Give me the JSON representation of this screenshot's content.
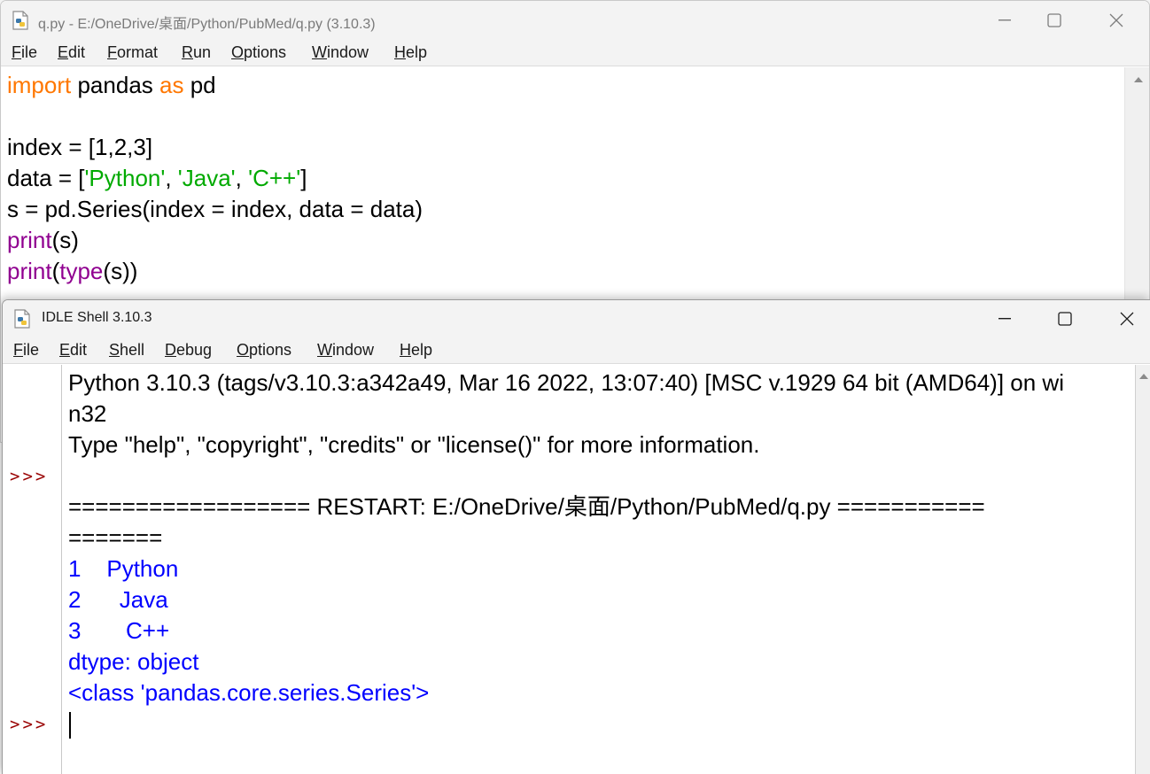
{
  "editor": {
    "title": "q.py - E:/OneDrive/桌面/Python/PubMed/q.py (3.10.3)",
    "menu": [
      "File",
      "Edit",
      "Format",
      "Run",
      "Options",
      "Window",
      "Help"
    ],
    "code": [
      [
        {
          "t": "import",
          "c": "kw"
        },
        {
          "t": " pandas ",
          "c": ""
        },
        {
          "t": "as",
          "c": "kw"
        },
        {
          "t": " pd",
          "c": ""
        }
      ],
      [],
      [
        {
          "t": "index = [1,2,3]",
          "c": ""
        }
      ],
      [
        {
          "t": "data = [",
          "c": ""
        },
        {
          "t": "'Python'",
          "c": "st"
        },
        {
          "t": ", ",
          "c": ""
        },
        {
          "t": "'Java'",
          "c": "st"
        },
        {
          "t": ", ",
          "c": ""
        },
        {
          "t": "'C++'",
          "c": "st"
        },
        {
          "t": "]",
          "c": ""
        }
      ],
      [
        {
          "t": "s = pd.Series(index = index, data = data)",
          "c": ""
        }
      ],
      [
        {
          "t": "print",
          "c": "bi"
        },
        {
          "t": "(s)",
          "c": ""
        }
      ],
      [
        {
          "t": "print",
          "c": "bi"
        },
        {
          "t": "(",
          "c": ""
        },
        {
          "t": "type",
          "c": "bi"
        },
        {
          "t": "(s))",
          "c": ""
        }
      ]
    ]
  },
  "shell": {
    "title": "IDLE Shell 3.10.3",
    "menu": [
      "File",
      "Edit",
      "Shell",
      "Debug",
      "Options",
      "Window",
      "Help"
    ],
    "prompt": ">>>",
    "lines": [
      {
        "text": "Python 3.10.3 (tags/v3.10.3:a342a49, Mar 16 2022, 13:07:40) [MSC v.1929 64 bit (AMD64)] on wi",
        "kind": "plain",
        "prompt": false
      },
      {
        "text": "n32",
        "kind": "plain",
        "prompt": false
      },
      {
        "text": "Type \"help\", \"copyright\", \"credits\" or \"license()\" for more information.",
        "kind": "plain",
        "prompt": false
      },
      {
        "text": "",
        "kind": "plain",
        "prompt": true
      },
      {
        "text": "================== RESTART: E:/OneDrive/桌面/Python/PubMed/q.py ===========",
        "kind": "plain",
        "prompt": false
      },
      {
        "text": "=======",
        "kind": "plain",
        "prompt": false
      },
      {
        "text": "1    Python",
        "kind": "out",
        "prompt": false
      },
      {
        "text": "2      Java",
        "kind": "out",
        "prompt": false
      },
      {
        "text": "3       C++",
        "kind": "out",
        "prompt": false
      },
      {
        "text": "dtype: object",
        "kind": "out",
        "prompt": false
      },
      {
        "text": "<class 'pandas.core.series.Series'>",
        "kind": "out",
        "prompt": false
      },
      {
        "text": "",
        "kind": "input",
        "prompt": true
      }
    ]
  },
  "colors": {
    "keyword": "#ff7700",
    "builtin": "#900090",
    "string": "#00aa00",
    "stdout": "#0000ff",
    "prompt": "#990000"
  }
}
